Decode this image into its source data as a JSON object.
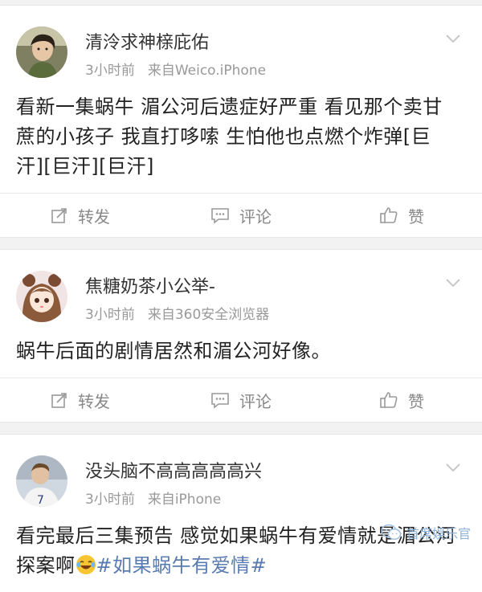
{
  "posts": [
    {
      "username": "清泠求神榇庇佑",
      "time": "3小时前",
      "source": "来自Weico.iPhone",
      "text": "看新一集蜗牛 湄公河后遗症好严重 看见那个卖甘蔗的小孩子 我直打哆嗦 生怕他也点燃个炸弹[巨汗][巨汗][巨汗]",
      "avatar_icon": "avatar-photo-man"
    },
    {
      "username": "焦糖奶茶小公举-",
      "time": "3小时前",
      "source": "来自360安全浏览器",
      "text": "蜗牛后面的剧情居然和湄公河好像。",
      "avatar_icon": "avatar-anime-girl"
    },
    {
      "username": "没头脑不高高高高高兴",
      "time": "3小时前",
      "source": "来自iPhone",
      "text": "看完最后三集预告 感觉如果蜗牛有爱情就是湄公河探案啊",
      "emoji": "laugh-cry-emoji",
      "topic": "#如果蜗牛有爱情#",
      "avatar_icon": "avatar-photo-athlete"
    }
  ],
  "actions": {
    "repost": "转发",
    "comment": "评论",
    "like": "赞"
  },
  "watermark": "首席娱乐官",
  "colors": {
    "topic": "#5a7bb0",
    "meta": "#999999",
    "action": "#888888",
    "background": "#f2f2f2"
  }
}
